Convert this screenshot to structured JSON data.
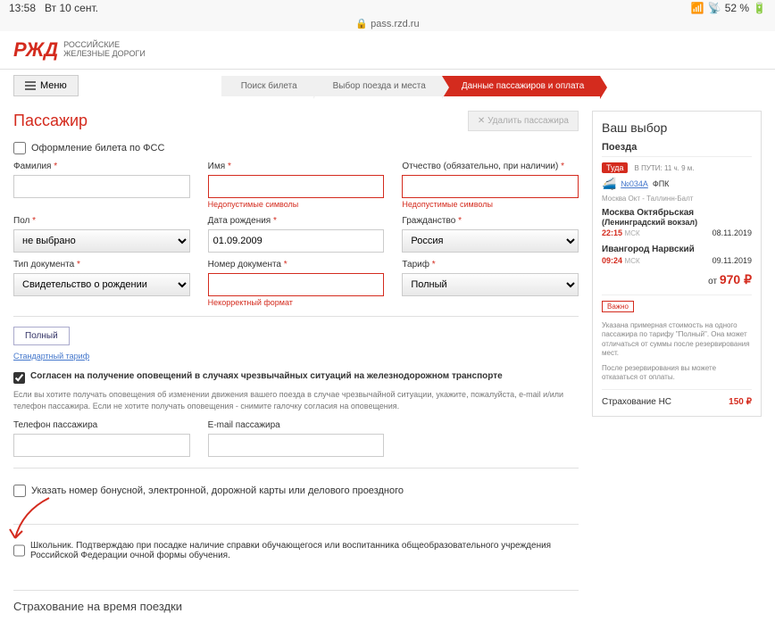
{
  "status": {
    "time": "13:58",
    "date": "Вт 10 сент.",
    "battery": "52 %"
  },
  "address": "pass.rzd.ru",
  "logo": {
    "brand": "РЖД",
    "line1": "Российские",
    "line2": "железные дороги"
  },
  "menu_label": "Меню",
  "breadcrumb": {
    "step1": "Поиск билета",
    "step2": "Выбор поезда и места",
    "step3": "Данные пассажиров и оплата"
  },
  "page_title": "Пассажир",
  "delete_btn": "Удалить пассажира",
  "fss_checkbox": "Оформление билета по ФСС",
  "labels": {
    "surname": "Фамилия",
    "name": "Имя",
    "patronymic": "Отчество (обязательно, при наличии)",
    "gender": "Пол",
    "birthdate": "Дата рождения",
    "citizenship": "Гражданство",
    "doctype": "Тип документа",
    "docnumber": "Номер документа",
    "tariff": "Тариф",
    "phone": "Телефон пассажира",
    "email": "E-mail пассажира"
  },
  "values": {
    "gender": "не выбрано",
    "birthdate": "01.09.2009",
    "citizenship": "Россия",
    "doctype": "Свидетельство о рождении",
    "tariff": "Полный"
  },
  "errors": {
    "invalid_chars": "Недопустимые символы",
    "invalid_format": "Некорректный формат"
  },
  "tariff_section": {
    "btn": "Полный",
    "link": "Стандартный тариф"
  },
  "consent": {
    "main": "Согласен на получение оповещений в случаях чрезвычайных ситуаций на железнодорожном транспорте",
    "sub": "Если вы хотите получать оповещения об изменении движения вашего поезда в случае чрезвычайной ситуации, укажите, пожалуйста, e-mail и/или телефон пассажира.\nЕсли не хотите получать оповещения - снимите галочку согласия на оповещения."
  },
  "bonus_checkbox": "Указать номер бонусной, электронной, дорожной карты или делового проездного",
  "student_checkbox": "Школьник. Подтверждаю при посадке наличие справки обучающегося или воспитанника общеобразовательного учреждения Российской Федерации очной формы обучения.",
  "travel_insurance_hdr": "Страхование на время поездки",
  "sidebar": {
    "title": "Ваш выбор",
    "trains_hdr": "Поезда",
    "direction": "Туда",
    "duration": "В ПУТИ: 11 ч. 9 м.",
    "train_no": "№034А",
    "train_carrier": "ФПК",
    "route": "Москва Окт - Таллинн-Балт",
    "dep_station": "Москва Октябрьская",
    "dep_station_sub": "(Ленинградский вокзал)",
    "arr_station": "Ивангород Нарвский",
    "dep_time": "22:15",
    "dep_date": "08.11.2019",
    "arr_time": "09:24",
    "arr_date": "09.11.2019",
    "tz": "МСК",
    "price_from": "от",
    "price": "970 ₽",
    "warning": "Важно",
    "note1": "Указана примерная стоимость на одного пассажира по тарифу \"Полный\". Она может отличаться от суммы после резервирования мест.",
    "note2": "После резервирования вы можете отказаться от оплаты.",
    "insurance_label": "Страхование НС",
    "insurance_price": "150 ₽"
  }
}
